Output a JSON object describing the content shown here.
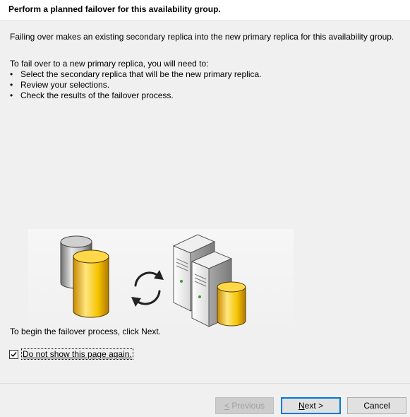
{
  "header": {
    "title": "Perform a planned failover for this availability group."
  },
  "content": {
    "intro": "Failing over makes an existing secondary replica into the new primary replica for this availability group.",
    "need_intro": "To fail over to a new primary replica, you will need to:",
    "steps": [
      "Select the secondary replica that will be the new primary replica.",
      "Review your selections.",
      "Check the results of the failover process."
    ],
    "begin_text": "To begin the failover process, click Next.",
    "checkbox": {
      "label": "Do not show this page again.",
      "checked": true
    }
  },
  "footer": {
    "previous_mnemonic": "<",
    "previous_rest": " Previous",
    "next_label": "Next >",
    "next_mnemonic": "N",
    "next_rest": "ext >",
    "cancel_label": "Cancel"
  },
  "icons": {
    "database": "database-icon",
    "sync": "sync-arrows-icon",
    "servers": "server-database-icon"
  },
  "colors": {
    "accent": "#0078d7",
    "db_gold": "#f5c400",
    "db_gray": "#9a9a9a"
  }
}
